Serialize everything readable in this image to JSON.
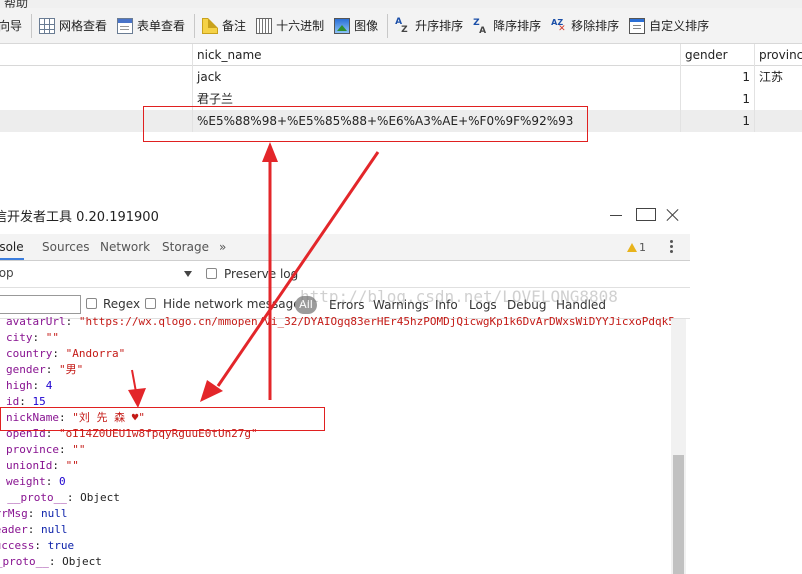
{
  "app_menu": {
    "label": "帮助"
  },
  "toolbar": {
    "items": [
      {
        "label": "导向导",
        "icon": "wizard-icon"
      },
      {
        "label": "网格查看",
        "icon": "grid-icon"
      },
      {
        "label": "表单查看",
        "icon": "form-icon"
      },
      {
        "label": "备注",
        "icon": "note-icon"
      },
      {
        "label": "十六进制",
        "icon": "hex-icon"
      },
      {
        "label": "图像",
        "icon": "image-icon"
      },
      {
        "label": "升序排序",
        "icon": "sort-asc-icon"
      },
      {
        "label": "降序排序",
        "icon": "sort-desc-icon"
      },
      {
        "label": "移除排序",
        "icon": "remove-sort-icon"
      },
      {
        "label": "自定义排序",
        "icon": "custom-sort-icon"
      }
    ]
  },
  "grid": {
    "columns": [
      "nick_name",
      "gender",
      "province"
    ],
    "rows": [
      {
        "nick_name": "jack",
        "gender": "1",
        "province": "江苏"
      },
      {
        "nick_name": "君子兰",
        "gender": "1",
        "province": ""
      },
      {
        "nick_name": "%E5%88%98+%E5%85%88+%E6%A3%AE+%F0%9F%92%93",
        "gender": "1",
        "province": ""
      }
    ]
  },
  "devtools": {
    "title": "信开发者工具 0.20.191900",
    "tabs": [
      "Console",
      "Sources",
      "Network",
      "Storage",
      "»"
    ],
    "active_tab": "Console",
    "warning_count": "1",
    "context": "top",
    "preserve_log_label": "Preserve log",
    "regex_label": "Regex",
    "hide_network_label": "Hide network messages",
    "all_label": "All",
    "levels": [
      "Errors",
      "Warnings",
      "Info",
      "Logs",
      "Debug",
      "Handled"
    ],
    "watermark": "http://blog.csdn.net/LOVELONG8808",
    "console_lines": [
      {
        "key": "avatarUrl",
        "value": "\"https://wx.qlogo.cn/mmopen/vi_32/DYAIOgq83erHEr45hzPOMDjQicwgKp1k6DvArDWxsWiDYYJicxoPdqk5",
        "kind": "s"
      },
      {
        "key": "city",
        "value": "\"\"",
        "kind": "s"
      },
      {
        "key": "country",
        "value": "\"Andorra\"",
        "kind": "s"
      },
      {
        "key": "gender",
        "value": "\"男\"",
        "kind": "s"
      },
      {
        "key": "high",
        "value": "4",
        "kind": "n"
      },
      {
        "key": "id",
        "value": "15",
        "kind": "n"
      },
      {
        "key": "nickName",
        "value": "\"刘 先 森 ♥\"",
        "kind": "s"
      },
      {
        "key": "openId",
        "value": "\"oI14Z0UEU1w8fpqyRguuE0tUn27g\"",
        "kind": "s"
      },
      {
        "key": "province",
        "value": "\"\"",
        "kind": "s"
      },
      {
        "key": "unionId",
        "value": "\"\"",
        "kind": "s"
      },
      {
        "key": "weight",
        "value": "0",
        "kind": "n"
      },
      {
        "key": "__proto__",
        "value": "Object",
        "kind": "p"
      },
      {
        "key": "errMsg",
        "value": "null",
        "kind": "kw"
      },
      {
        "key": "header",
        "value": "null",
        "kind": "kw"
      },
      {
        "key": "success",
        "value": "true",
        "kind": "kw"
      },
      {
        "key": "__proto__",
        "value": "Object",
        "kind": "p"
      }
    ]
  }
}
